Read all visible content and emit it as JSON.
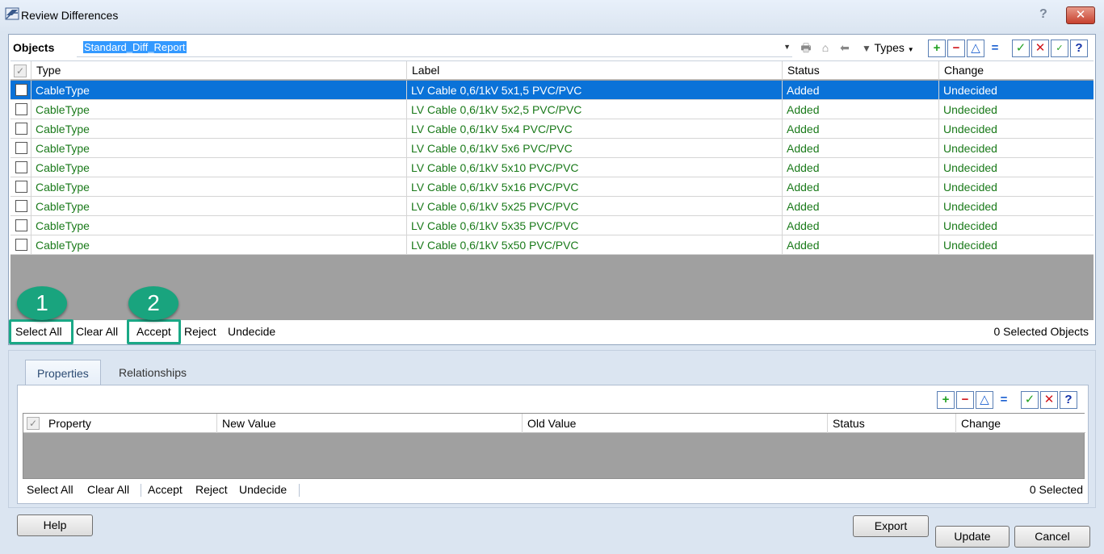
{
  "window": {
    "title": "Review Differences",
    "help_glyph": "?",
    "close_glyph": "✕"
  },
  "objects": {
    "label": "Objects",
    "report_name": "Standard_Diff_Report",
    "types_label": "Types",
    "toolbar_glyphs": {
      "add": "+",
      "remove": "−",
      "delta": "△",
      "equal": "=",
      "accept": "✓",
      "reject": "✕",
      "partial": "✓",
      "help": "?"
    },
    "columns": [
      "Type",
      "Label",
      "Status",
      "Change"
    ],
    "rows": [
      {
        "type": "CableType",
        "label": "LV Cable 0,6/1kV 5x1,5 PVC/PVC",
        "status": "Added",
        "change": "Undecided"
      },
      {
        "type": "CableType",
        "label": "LV Cable 0,6/1kV 5x2,5 PVC/PVC",
        "status": "Added",
        "change": "Undecided"
      },
      {
        "type": "CableType",
        "label": "LV Cable 0,6/1kV 5x4 PVC/PVC",
        "status": "Added",
        "change": "Undecided"
      },
      {
        "type": "CableType",
        "label": "LV Cable 0,6/1kV 5x6 PVC/PVC",
        "status": "Added",
        "change": "Undecided"
      },
      {
        "type": "CableType",
        "label": "LV Cable 0,6/1kV 5x10 PVC/PVC",
        "status": "Added",
        "change": "Undecided"
      },
      {
        "type": "CableType",
        "label": "LV Cable 0,6/1kV 5x16 PVC/PVC",
        "status": "Added",
        "change": "Undecided"
      },
      {
        "type": "CableType",
        "label": "LV Cable 0,6/1kV 5x25 PVC/PVC",
        "status": "Added",
        "change": "Undecided"
      },
      {
        "type": "CableType",
        "label": "LV Cable 0,6/1kV 5x35 PVC/PVC",
        "status": "Added",
        "change": "Undecided"
      },
      {
        "type": "CableType",
        "label": "LV Cable 0,6/1kV 5x50 PVC/PVC",
        "status": "Added",
        "change": "Undecided"
      }
    ],
    "actions": {
      "select_all": "Select All",
      "clear_all": "Clear All",
      "accept": "Accept",
      "reject": "Reject",
      "undecide": "Undecide"
    },
    "selected_count": "0 Selected Objects"
  },
  "callouts": {
    "one": "1",
    "two": "2"
  },
  "details": {
    "tabs": [
      "Properties",
      "Relationships"
    ],
    "columns": [
      "Property",
      "New Value",
      "Old Value",
      "Status",
      "Change"
    ],
    "actions": {
      "select_all": "Select All",
      "clear_all": "Clear All",
      "accept": "Accept",
      "reject": "Reject",
      "undecide": "Undecide"
    },
    "selected_count": "0 Selected"
  },
  "footer": {
    "help": "Help",
    "export": "Export",
    "update": "Update",
    "cancel": "Cancel"
  },
  "colors": {
    "selection": "#0a72d8",
    "added_text": "#1a7a1a",
    "callout": "#19a47e"
  }
}
